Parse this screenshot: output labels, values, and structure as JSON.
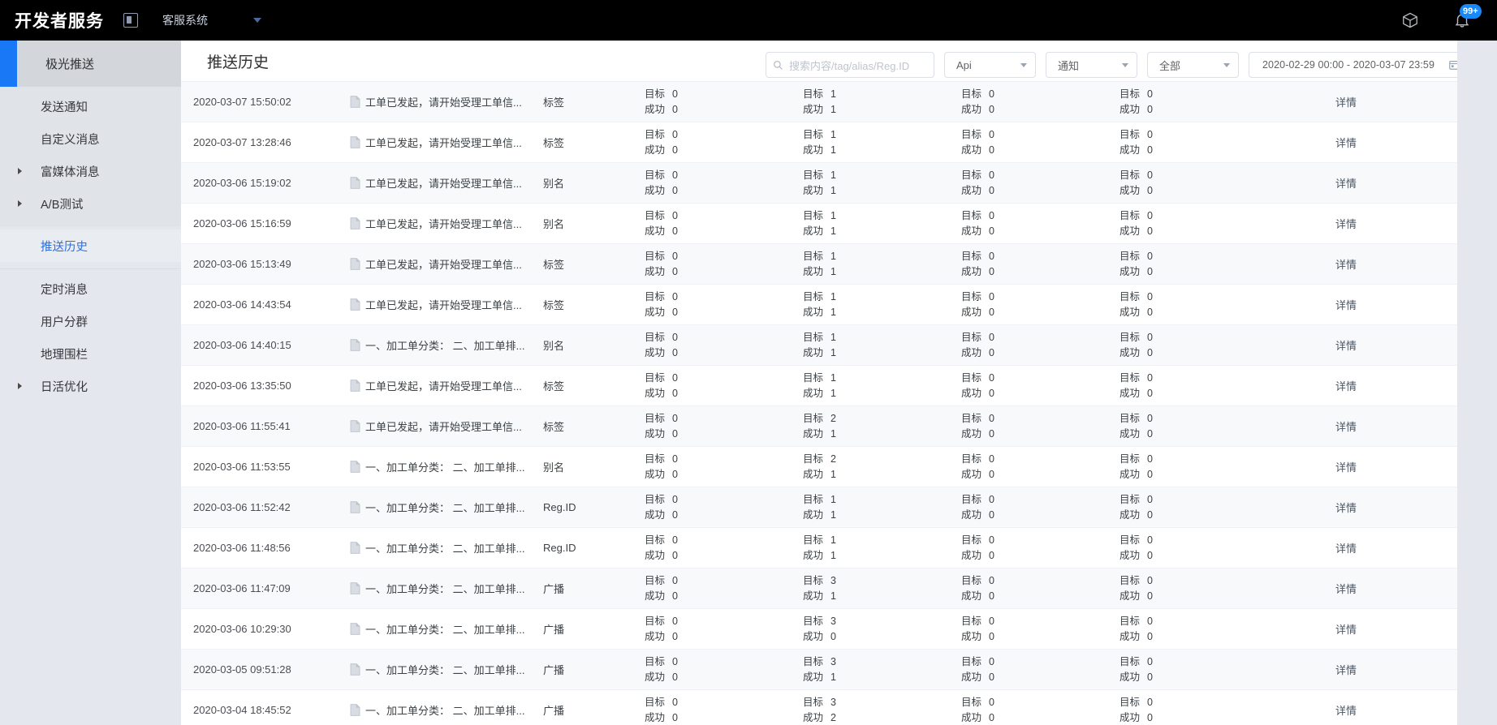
{
  "topbar": {
    "brand": "开发者服务",
    "collapse_icon": "panel-collapse-icon",
    "project": "客服系统",
    "cube_icon": "cube-icon",
    "bell_icon": "bell-icon",
    "notification_badge": "99+"
  },
  "sidebar": {
    "header": "极光推送",
    "groups": [
      {
        "items": [
          {
            "label": "发送通知",
            "expandable": false,
            "active": false
          },
          {
            "label": "自定义消息",
            "expandable": false,
            "active": false
          },
          {
            "label": "富媒体消息",
            "expandable": true,
            "active": false
          },
          {
            "label": "A/B测试",
            "expandable": true,
            "active": false
          }
        ]
      },
      {
        "items": [
          {
            "label": "推送历史",
            "expandable": false,
            "active": true
          }
        ]
      },
      {
        "items": [
          {
            "label": "定时消息",
            "expandable": false,
            "active": false
          },
          {
            "label": "用户分群",
            "expandable": false,
            "active": false
          },
          {
            "label": "地理围栏",
            "expandable": false,
            "active": false
          },
          {
            "label": "日活优化",
            "expandable": true,
            "active": false
          }
        ]
      }
    ]
  },
  "page": {
    "title": "推送历史"
  },
  "toolbar": {
    "search_placeholder": "搜索内容/tag/alias/Reg.ID",
    "search_value": "",
    "search_icon": "search-icon",
    "filter_channel": "Api",
    "filter_type": "通知",
    "filter_status": "全部",
    "date_range": "2020-02-29 00:00 - 2020-03-07 23:59",
    "calendar_icon": "calendar-icon"
  },
  "table": {
    "stat_target_label": "目标",
    "stat_success_label": "成功",
    "detail_label": "详情",
    "rows": [
      {
        "time": "2020-03-07 15:50:02",
        "content": "工单已发起，请开始受理工单信...",
        "target_type": "标签",
        "stats": [
          {
            "t": "0",
            "s": "0"
          },
          {
            "t": "1",
            "s": "1"
          },
          {
            "t": "0",
            "s": "0"
          },
          {
            "t": "0",
            "s": "0"
          }
        ]
      },
      {
        "time": "2020-03-07 13:28:46",
        "content": "工单已发起，请开始受理工单信...",
        "target_type": "标签",
        "stats": [
          {
            "t": "0",
            "s": "0"
          },
          {
            "t": "1",
            "s": "1"
          },
          {
            "t": "0",
            "s": "0"
          },
          {
            "t": "0",
            "s": "0"
          }
        ]
      },
      {
        "time": "2020-03-06 15:19:02",
        "content": "工单已发起，请开始受理工单信...",
        "target_type": "别名",
        "stats": [
          {
            "t": "0",
            "s": "0"
          },
          {
            "t": "1",
            "s": "1"
          },
          {
            "t": "0",
            "s": "0"
          },
          {
            "t": "0",
            "s": "0"
          }
        ]
      },
      {
        "time": "2020-03-06 15:16:59",
        "content": "工单已发起，请开始受理工单信...",
        "target_type": "别名",
        "stats": [
          {
            "t": "0",
            "s": "0"
          },
          {
            "t": "1",
            "s": "1"
          },
          {
            "t": "0",
            "s": "0"
          },
          {
            "t": "0",
            "s": "0"
          }
        ]
      },
      {
        "time": "2020-03-06 15:13:49",
        "content": "工单已发起，请开始受理工单信...",
        "target_type": "标签",
        "stats": [
          {
            "t": "0",
            "s": "0"
          },
          {
            "t": "1",
            "s": "1"
          },
          {
            "t": "0",
            "s": "0"
          },
          {
            "t": "0",
            "s": "0"
          }
        ]
      },
      {
        "time": "2020-03-06 14:43:54",
        "content": "工单已发起，请开始受理工单信...",
        "target_type": "标签",
        "stats": [
          {
            "t": "0",
            "s": "0"
          },
          {
            "t": "1",
            "s": "1"
          },
          {
            "t": "0",
            "s": "0"
          },
          {
            "t": "0",
            "s": "0"
          }
        ]
      },
      {
        "time": "2020-03-06 14:40:15",
        "content": "一、加工单分类：  二、加工单排...",
        "target_type": "别名",
        "stats": [
          {
            "t": "0",
            "s": "0"
          },
          {
            "t": "1",
            "s": "1"
          },
          {
            "t": "0",
            "s": "0"
          },
          {
            "t": "0",
            "s": "0"
          }
        ]
      },
      {
        "time": "2020-03-06 13:35:50",
        "content": "工单已发起，请开始受理工单信...",
        "target_type": "标签",
        "stats": [
          {
            "t": "0",
            "s": "0"
          },
          {
            "t": "1",
            "s": "1"
          },
          {
            "t": "0",
            "s": "0"
          },
          {
            "t": "0",
            "s": "0"
          }
        ]
      },
      {
        "time": "2020-03-06 11:55:41",
        "content": "工单已发起，请开始受理工单信...",
        "target_type": "标签",
        "stats": [
          {
            "t": "0",
            "s": "0"
          },
          {
            "t": "2",
            "s": "1"
          },
          {
            "t": "0",
            "s": "0"
          },
          {
            "t": "0",
            "s": "0"
          }
        ]
      },
      {
        "time": "2020-03-06 11:53:55",
        "content": "一、加工单分类：  二、加工单排...",
        "target_type": "别名",
        "stats": [
          {
            "t": "0",
            "s": "0"
          },
          {
            "t": "2",
            "s": "1"
          },
          {
            "t": "0",
            "s": "0"
          },
          {
            "t": "0",
            "s": "0"
          }
        ]
      },
      {
        "time": "2020-03-06 11:52:42",
        "content": "一、加工单分类：  二、加工单排...",
        "target_type": "Reg.ID",
        "stats": [
          {
            "t": "0",
            "s": "0"
          },
          {
            "t": "1",
            "s": "1"
          },
          {
            "t": "0",
            "s": "0"
          },
          {
            "t": "0",
            "s": "0"
          }
        ]
      },
      {
        "time": "2020-03-06 11:48:56",
        "content": "一、加工单分类：  二、加工单排...",
        "target_type": "Reg.ID",
        "stats": [
          {
            "t": "0",
            "s": "0"
          },
          {
            "t": "1",
            "s": "1"
          },
          {
            "t": "0",
            "s": "0"
          },
          {
            "t": "0",
            "s": "0"
          }
        ]
      },
      {
        "time": "2020-03-06 11:47:09",
        "content": "一、加工单分类：  二、加工单排...",
        "target_type": "广播",
        "stats": [
          {
            "t": "0",
            "s": "0"
          },
          {
            "t": "3",
            "s": "1"
          },
          {
            "t": "0",
            "s": "0"
          },
          {
            "t": "0",
            "s": "0"
          }
        ]
      },
      {
        "time": "2020-03-06 10:29:30",
        "content": "一、加工单分类：  二、加工单排...",
        "target_type": "广播",
        "stats": [
          {
            "t": "0",
            "s": "0"
          },
          {
            "t": "3",
            "s": "0"
          },
          {
            "t": "0",
            "s": "0"
          },
          {
            "t": "0",
            "s": "0"
          }
        ]
      },
      {
        "time": "2020-03-05 09:51:28",
        "content": "一、加工单分类：  二、加工单排...",
        "target_type": "广播",
        "stats": [
          {
            "t": "0",
            "s": "0"
          },
          {
            "t": "3",
            "s": "1"
          },
          {
            "t": "0",
            "s": "0"
          },
          {
            "t": "0",
            "s": "0"
          }
        ]
      },
      {
        "time": "2020-03-04 18:45:52",
        "content": "一、加工单分类：  二、加工单排...",
        "target_type": "广播",
        "stats": [
          {
            "t": "0",
            "s": "0"
          },
          {
            "t": "3",
            "s": "2"
          },
          {
            "t": "0",
            "s": "0"
          },
          {
            "t": "0",
            "s": "0"
          }
        ]
      }
    ]
  }
}
